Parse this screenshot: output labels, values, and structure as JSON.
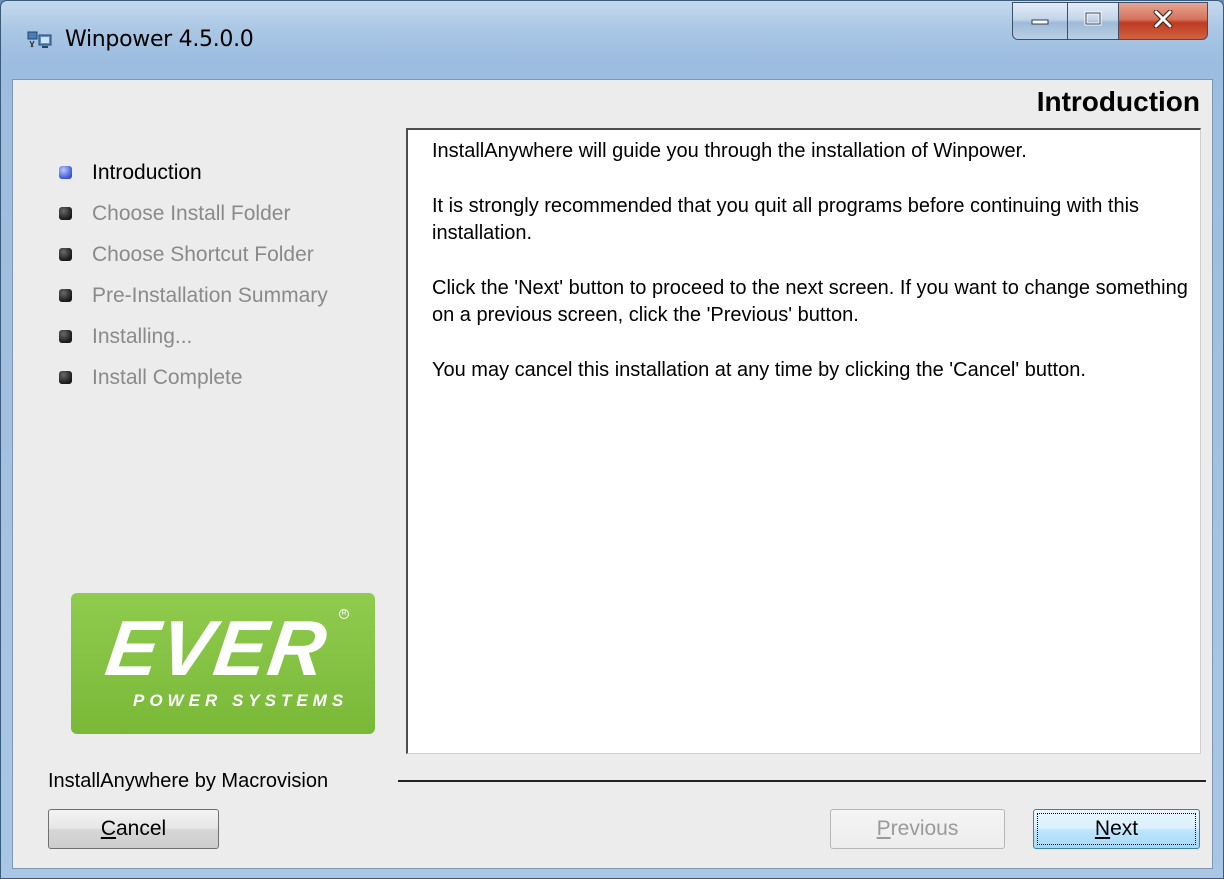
{
  "window": {
    "title": "Winpower 4.5.0.0",
    "icon": "winpower-app-icon",
    "controls": {
      "minimize": "minimize-icon",
      "maximize": "maximize-icon",
      "close": "close-icon"
    }
  },
  "header": {
    "title": "Introduction"
  },
  "steps": [
    {
      "label": "Introduction",
      "state": "active"
    },
    {
      "label": "Choose Install Folder",
      "state": "pending"
    },
    {
      "label": "Choose Shortcut Folder",
      "state": "pending"
    },
    {
      "label": "Pre-Installation Summary",
      "state": "pending"
    },
    {
      "label": "Installing...",
      "state": "pending"
    },
    {
      "label": "Install Complete",
      "state": "pending"
    }
  ],
  "logo": {
    "brand": "EVER",
    "tagline": "POWER SYSTEMS",
    "registered": "R",
    "color": "#80be3e"
  },
  "content": {
    "paragraphs": [
      "InstallAnywhere will guide you through the installation of Winpower.",
      "It is strongly recommended that you quit all programs before continuing with this installation.",
      "Click the 'Next' button to proceed to the next screen. If you want to change something on a previous screen, click the 'Previous' button.",
      "You may cancel this installation at any time by clicking the 'Cancel' button."
    ]
  },
  "footer": {
    "vendor": "InstallAnywhere by Macrovision",
    "cancel": {
      "mnemonic": "C",
      "rest": "ancel"
    },
    "previous": {
      "mnemonic": "P",
      "rest": "revious",
      "enabled": false
    },
    "next": {
      "mnemonic": "N",
      "rest": "ext",
      "enabled": true
    }
  }
}
